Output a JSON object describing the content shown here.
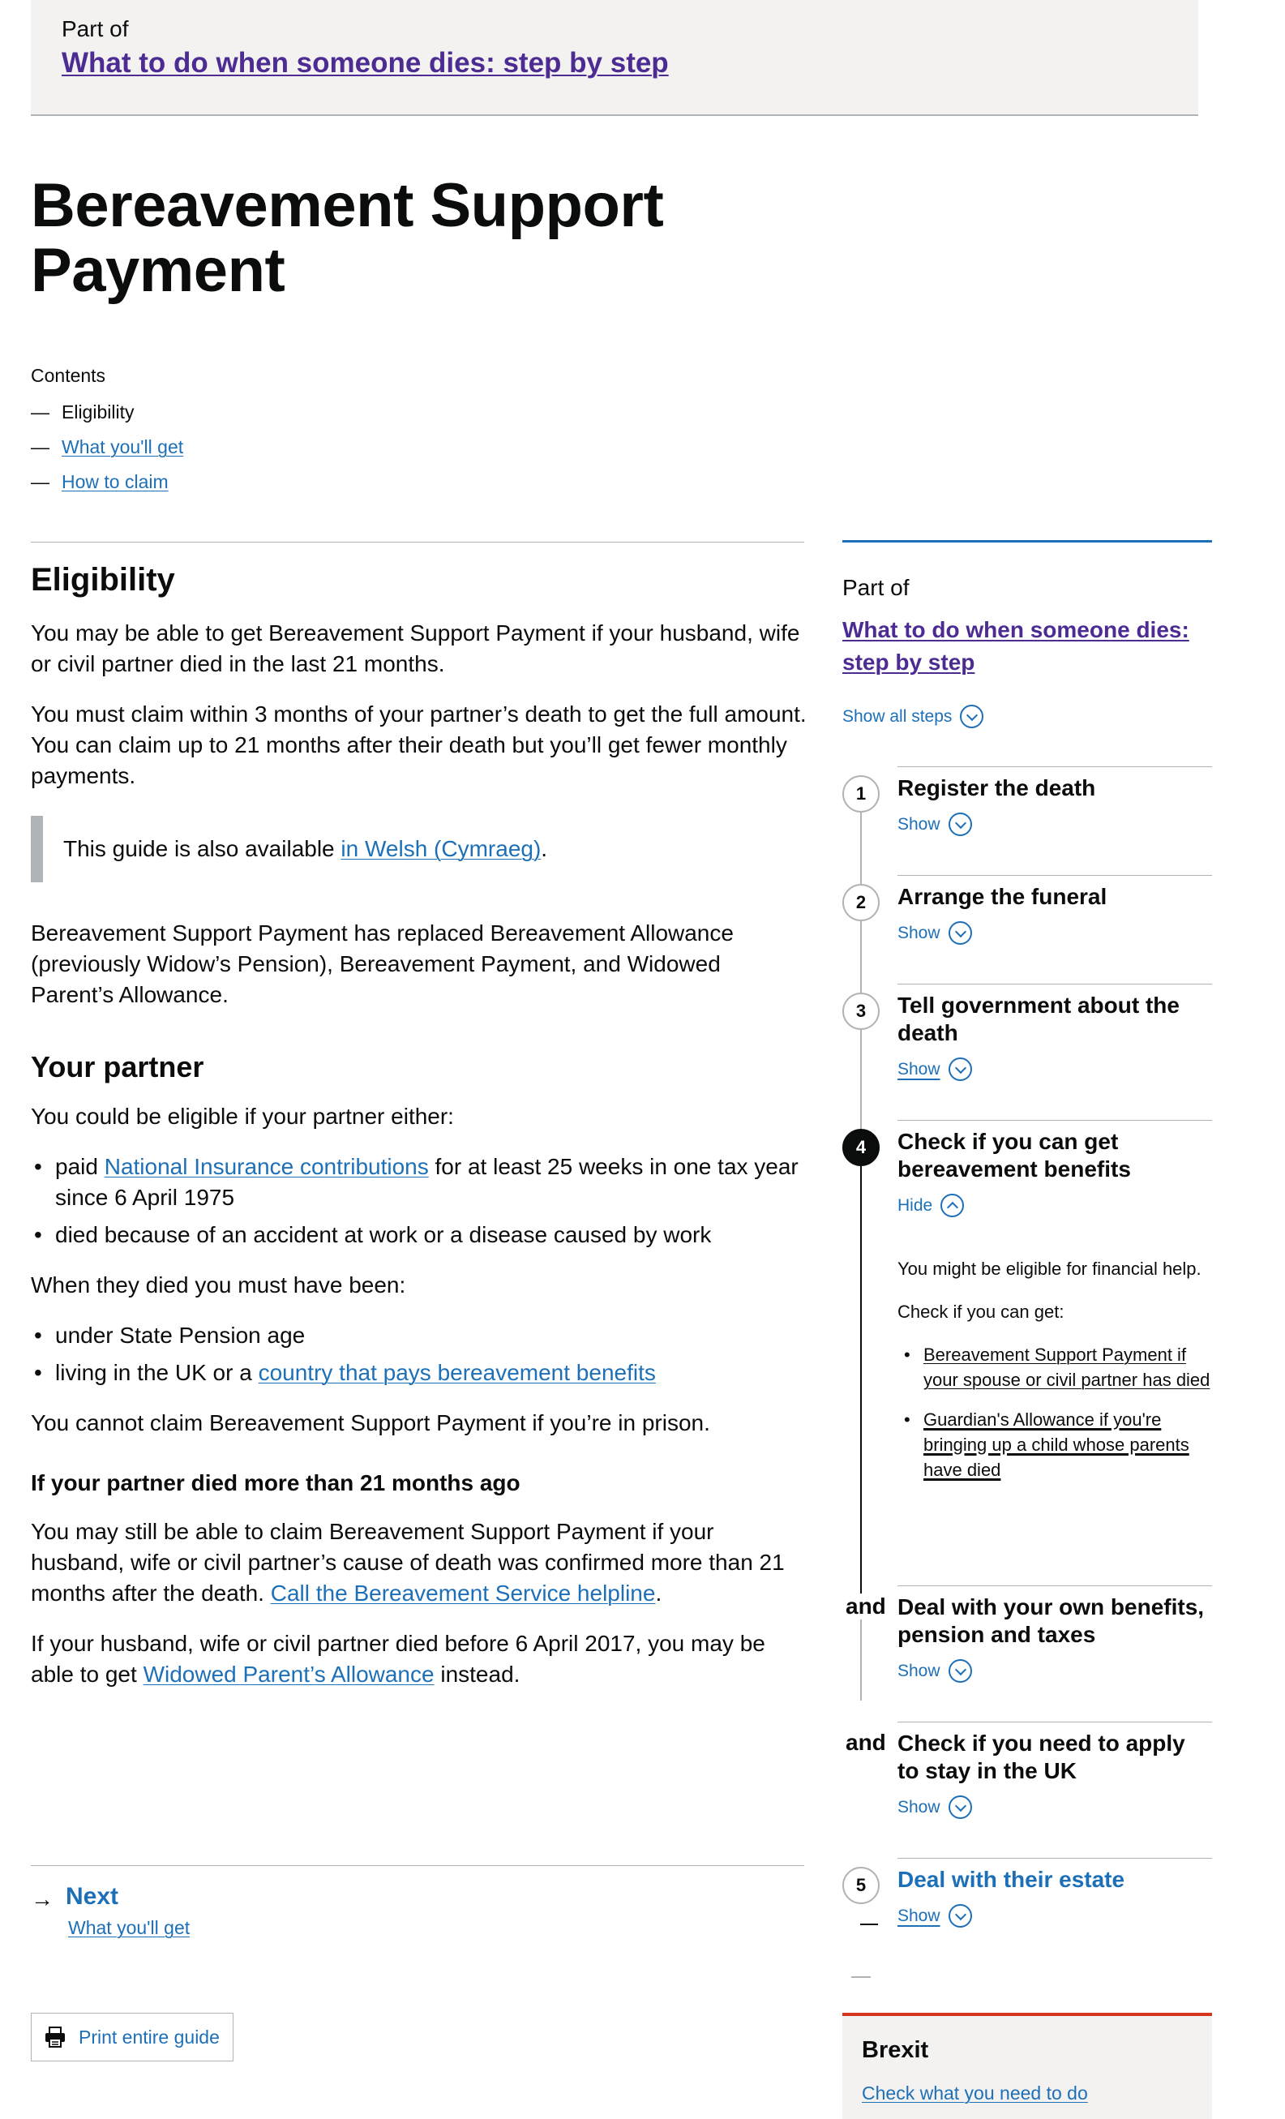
{
  "banner": {
    "part_of": "Part of",
    "series_title": "What to do when someone dies: step by step"
  },
  "page_title": "Bereavement Support Payment",
  "contents": {
    "label": "Contents",
    "dash": "—",
    "items": [
      "Eligibility",
      "What you'll get",
      "How to claim"
    ]
  },
  "main": {
    "heading": "Eligibility",
    "p1": "You may be able to get Bereavement Support Payment if your husband, wife or civil partner died in the last 21 months.",
    "p2": "You must claim within 3 months of your partner’s death to get the full amount. You can claim up to 21 months after their death but you’ll get fewer monthly payments.",
    "inset_before": "This guide is also available ",
    "inset_link": "in Welsh (Cymraeg)",
    "inset_after": ".",
    "p3": "Bereavement Support Payment has replaced Bereavement Allowance (previously Widow’s Pension), Bereavement Payment, and Widowed Parent’s Allowance.",
    "partner_heading": "Your partner",
    "partner_intro": "You could be eligible if your partner either:",
    "partner_b1_before": "paid ",
    "partner_b1_link": "National Insurance contributions",
    "partner_b1_after": " for at least 25 weeks in one tax year since 6 April 1975",
    "partner_b2": "died because of an accident at work or a disease caused by work",
    "when_died": "When they died you must have been:",
    "when_b1": "under State Pension age",
    "when_b2_before": "living in the UK or a ",
    "when_b2_link": "country that pays bereavement benefits",
    "prison": "You cannot claim Bereavement Support Payment if you’re in prison.",
    "over21_heading": "If your partner died more than 21 months ago",
    "over21_p1_before": "You may still be able to claim Bereavement Support Payment if your husband, wife or civil partner’s cause of death was confirmed more than 21 months after the death. ",
    "over21_p1_link": "Call the Bereavement Service helpline",
    "over21_p1_after": ".",
    "over21_p2_before": "If your husband, wife or civil partner died before 6 April 2017, you may be able to get ",
    "over21_p2_link": "Widowed Parent’s Allowance",
    "over21_p2_after": " instead."
  },
  "pagination": {
    "arrow": "→",
    "next_label": "Next",
    "next_sub": "What you'll get"
  },
  "print_label": "Print entire guide",
  "sidebar": {
    "part_of": "Part of",
    "series_title": "What to do when someone dies: step by step",
    "show_all": "Show all steps",
    "steps": [
      {
        "marker": "1",
        "title": "Register the death",
        "toggle": "Show"
      },
      {
        "marker": "2",
        "title": "Arrange the funeral",
        "toggle": "Show"
      },
      {
        "marker": "3",
        "title": "Tell government about the death",
        "toggle": "Show"
      },
      {
        "marker": "4",
        "title": "Check if you can get bereavement benefits",
        "toggle": "Hide"
      },
      {
        "marker": "and",
        "title": "Deal with your own benefits, pension and taxes",
        "toggle": "Show"
      },
      {
        "marker": "and",
        "title": "Check if you need to apply to stay in the UK",
        "toggle": "Show"
      },
      {
        "marker": "5",
        "title": "Deal with their estate",
        "toggle": "Show"
      }
    ],
    "step4_panel": {
      "p1": "You might be eligible for financial help.",
      "p2": "Check if you can get:",
      "links": [
        "Bereavement Support Payment if your spouse or civil partner has died",
        "Guardian's Allowance if you're bringing up a child whose parents have died"
      ]
    }
  },
  "brexit": {
    "title": "Brexit",
    "link": "Check what you need to do"
  },
  "colors": {
    "link": "#1d70b8",
    "visited": "#4c2c92",
    "text": "#0b0c0c",
    "rule": "#b1b4b6",
    "brexit_border": "#d4351c",
    "banner_bg": "#f3f2f1"
  }
}
